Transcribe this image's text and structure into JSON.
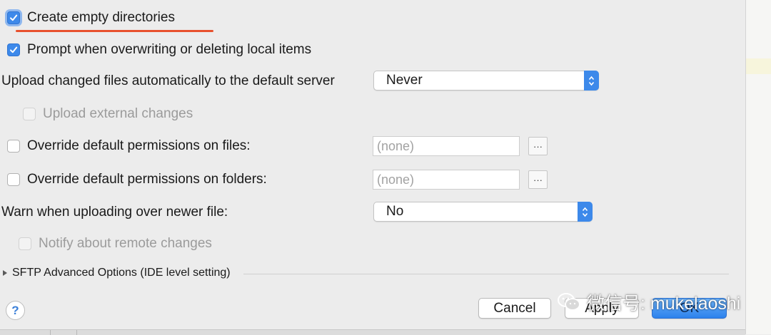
{
  "options": {
    "create_empty_dirs": {
      "label": "Create empty directories",
      "checked": true
    },
    "prompt_overwrite": {
      "label": "Prompt when overwriting or deleting local items",
      "checked": true
    },
    "upload_changed": {
      "label": "Upload changed files automatically to the default server",
      "value": "Never"
    },
    "upload_external": {
      "label": "Upload external changes",
      "checked": false,
      "enabled": false
    },
    "override_files": {
      "label": "Override default permissions on files:",
      "checked": false,
      "value": "(none)",
      "button": "···"
    },
    "override_folders": {
      "label": "Override default permissions on folders:",
      "checked": false,
      "value": "(none)",
      "button": "···"
    },
    "warn_newer": {
      "label": "Warn when uploading over newer file:",
      "value": "No"
    },
    "notify_remote": {
      "label": "Notify about remote changes",
      "checked": false,
      "enabled": false
    }
  },
  "advanced": {
    "label": "SFTP Advanced Options (IDE level setting)"
  },
  "footer": {
    "help": "?",
    "cancel": "Cancel",
    "apply": "Apply",
    "ok": "OK"
  },
  "watermark": {
    "text": "微信号: mukelaoshi"
  },
  "colors": {
    "accent": "#3d89ea",
    "annotation": "#e8512e",
    "background": "#ececec"
  }
}
